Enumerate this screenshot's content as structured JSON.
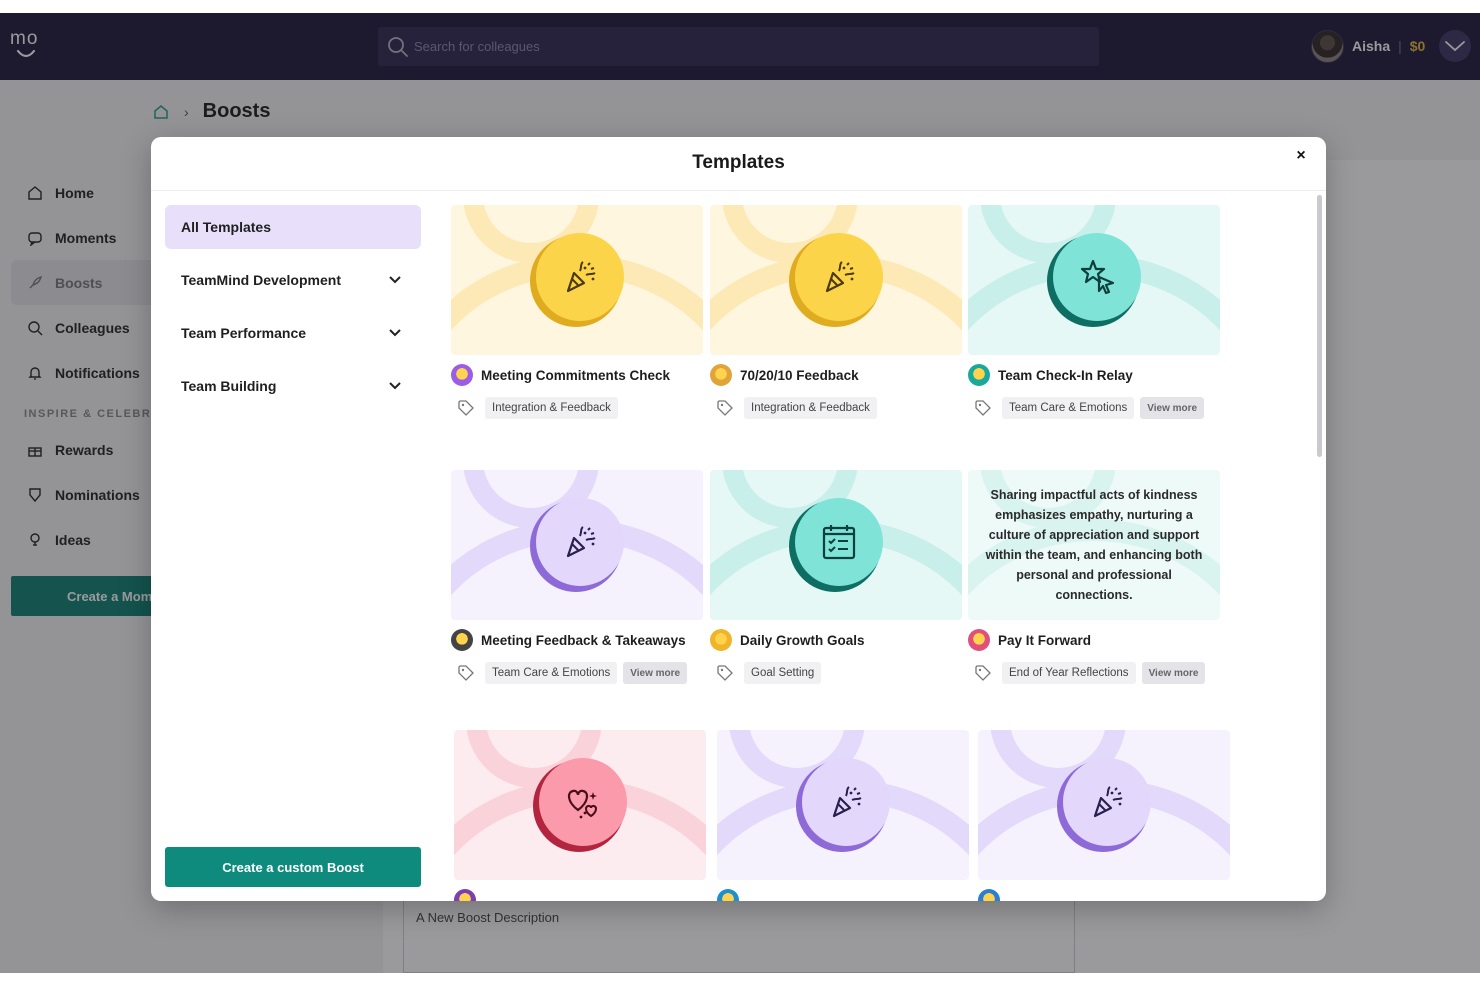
{
  "app": {
    "logo_text": "mo",
    "search_placeholder": "Search for colleagues",
    "user_name": "Aisha",
    "separator": "|",
    "balance": "$0"
  },
  "breadcrumb": {
    "title": "Boosts",
    "separator": "›"
  },
  "sidebar": {
    "items": [
      {
        "label": "Home",
        "icon": "home-icon"
      },
      {
        "label": "Moments",
        "icon": "moments-icon"
      },
      {
        "label": "Boosts",
        "icon": "rocket-icon"
      },
      {
        "label": "Colleagues",
        "icon": "search-icon"
      },
      {
        "label": "Notifications",
        "icon": "bell-icon"
      }
    ],
    "section_label": "INSPIRE & CELEBRA",
    "section_items": [
      {
        "label": "Rewards",
        "icon": "gift-icon"
      },
      {
        "label": "Nominations",
        "icon": "badge-icon"
      },
      {
        "label": "Ideas",
        "icon": "lightbulb-icon"
      }
    ],
    "cta_label": "Create a Mom"
  },
  "background": {
    "description_value": "A New Boost Description"
  },
  "modal": {
    "title": "Templates",
    "close_label": "×",
    "nav": [
      {
        "label": "All Templates",
        "selected": true,
        "expandable": false
      },
      {
        "label": "TeamMind Development",
        "selected": false,
        "expandable": true
      },
      {
        "label": "Team Performance",
        "selected": false,
        "expandable": true
      },
      {
        "label": "Team Building",
        "selected": false,
        "expandable": true
      }
    ],
    "custom_button": "Create a custom Boost",
    "cards": [
      {
        "title": "Meeting Commitments Check",
        "tag": "Integration & Feedback",
        "view_more": "",
        "theme": "yellow",
        "icon": "confetti-icon",
        "emoji_color": "#9b5de5"
      },
      {
        "title": "70/20/10 Feedback",
        "tag": "Integration & Feedback",
        "view_more": "",
        "theme": "yellow",
        "icon": "confetti-icon",
        "emoji_color": "#e0a43a"
      },
      {
        "title": "Team Check-In Relay",
        "tag": "Team Care & Emotions",
        "view_more": "View more",
        "theme": "teal",
        "icon": "star-cursor-icon",
        "emoji_color": "#18a99b"
      },
      {
        "title": "Meeting Feedback & Takeaways",
        "tag": "Team Care & Emotions",
        "view_more": "View more",
        "theme": "lavender",
        "icon": "confetti-icon",
        "emoji_color": "#444444"
      },
      {
        "title": "Daily Growth Goals",
        "tag": "Goal Setting",
        "view_more": "",
        "theme": "teal",
        "icon": "calendar-check-icon",
        "emoji_color": "#f0b429"
      },
      {
        "title": "Pay It Forward",
        "tag": "End of Year Reflections",
        "view_more": "View more",
        "theme": "teal-light",
        "icon": "",
        "emoji_color": "#e0507a",
        "description": "Sharing impactful acts of kindness emphasizes empathy, nurturing a culture of appreciation and support within the team, and enhancing both personal and professional connections."
      },
      {
        "title": "",
        "tag": "",
        "view_more": "",
        "theme": "pink",
        "icon": "hearts-icon",
        "emoji_color": "#7a3fb0"
      },
      {
        "title": "",
        "tag": "",
        "view_more": "",
        "theme": "lavender",
        "icon": "confetti-icon",
        "emoji_color": "#1c8fd0"
      },
      {
        "title": "",
        "tag": "",
        "view_more": "",
        "theme": "lavender",
        "icon": "confetti-icon",
        "emoji_color": "#2a7fd5"
      }
    ]
  },
  "colors": {
    "topbar": "#1c1537",
    "accent_teal": "#0f8b7d",
    "selected_nav": "#e8e0fa",
    "balance": "#e2b638"
  }
}
